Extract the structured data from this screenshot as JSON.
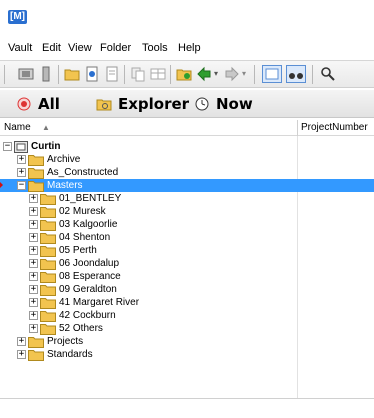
{
  "app": {
    "logo_text": "[M]"
  },
  "menu": {
    "items": [
      "Vault",
      "Edit",
      "View",
      "Folder",
      "Tools",
      "Help"
    ]
  },
  "toolbar": {
    "icons": [
      "vault-icon",
      "column-icon",
      "new-folder-icon",
      "open-icon",
      "document-icon",
      "copy-icon",
      "table-icon",
      "folder-star-icon",
      "back-arrow-icon",
      "forward-arrow-icon",
      "grid-view-icon",
      "binoculars-icon",
      "search-icon"
    ]
  },
  "tabs": [
    {
      "label": "All",
      "icon": "star-target-icon"
    },
    {
      "label": "Explorer",
      "icon": "explorer-folder-icon"
    },
    {
      "label": "Now",
      "icon": "clock-icon"
    }
  ],
  "columns": {
    "name": "Name",
    "project_number": "ProjectNumber"
  },
  "tree": {
    "root": "Curtin",
    "rows": [
      {
        "label": "Archive",
        "level": 1,
        "expander": "+"
      },
      {
        "label": "As_Constructed",
        "level": 1,
        "expander": "+"
      },
      {
        "label": "Masters",
        "level": 1,
        "expander": "−",
        "selected": true
      },
      {
        "label": "01_BENTLEY",
        "level": 2,
        "expander": "+"
      },
      {
        "label": "02 Muresk",
        "level": 2,
        "expander": "+"
      },
      {
        "label": "03 Kalgoorlie",
        "level": 2,
        "expander": "+"
      },
      {
        "label": "04 Shenton",
        "level": 2,
        "expander": "+"
      },
      {
        "label": "05 Perth",
        "level": 2,
        "expander": "+"
      },
      {
        "label": "06 Joondalup",
        "level": 2,
        "expander": "+"
      },
      {
        "label": "08 Esperance",
        "level": 2,
        "expander": "+"
      },
      {
        "label": "09 Geraldton",
        "level": 2,
        "expander": "+"
      },
      {
        "label": "41 Margaret River",
        "level": 2,
        "expander": "+"
      },
      {
        "label": "42 Cockburn",
        "level": 2,
        "expander": "+"
      },
      {
        "label": "52 Others",
        "level": 2,
        "expander": "+"
      },
      {
        "label": "Projects",
        "level": 1,
        "expander": "+"
      },
      {
        "label": "Standards",
        "level": 1,
        "expander": "+"
      }
    ]
  },
  "colors": {
    "selection": "#3399ff",
    "folder": "#f2c44f",
    "accent": "#2a6fd0"
  }
}
